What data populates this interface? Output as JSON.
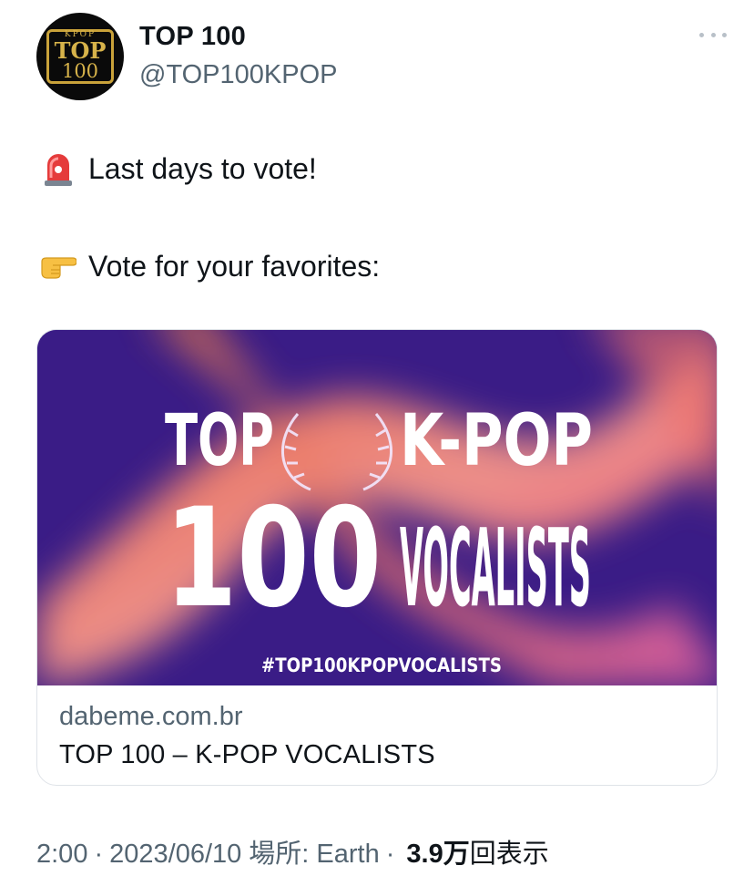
{
  "author": {
    "display_name": "TOP 100",
    "handle": "@TOP100KPOP",
    "avatar_text": [
      "KPOP",
      "TOP",
      "100"
    ]
  },
  "tweet": {
    "line1_text": "Last days to vote!",
    "line1_icon": "rotating-light-icon",
    "line2_text": "Vote for your favorites:",
    "line2_icon": "pointing-right-icon"
  },
  "card": {
    "image": {
      "left_word": "TOP",
      "number": "100",
      "right_word": "K-POP",
      "right_sub": "VOCALISTS",
      "hashtag": "#TOP100KPOPVOCALISTS"
    },
    "domain": "dabeme.com.br",
    "title": "TOP 100 – K-POP VOCALISTS"
  },
  "footer": {
    "time": "2:00",
    "date": "2023/06/10",
    "location": "場所: Earth",
    "views_count": "3.9",
    "views_unit": "万",
    "views_label": "回表示"
  },
  "colors": {
    "card_background": "#3a1c86",
    "secondary_text": "#536471",
    "avatar_gold": "#c9a23a"
  }
}
